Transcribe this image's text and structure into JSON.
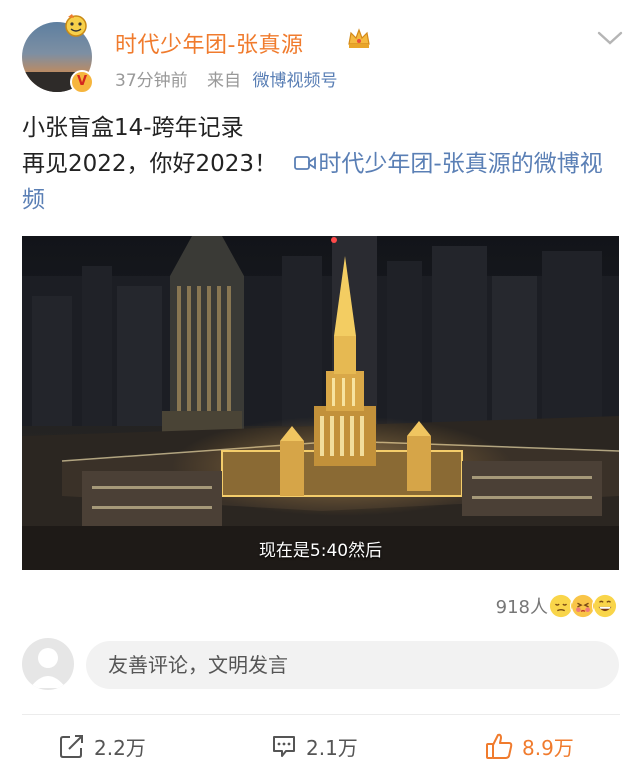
{
  "post": {
    "author": "时代少年团-张真源",
    "verified_badge": "V",
    "time": "37分钟前",
    "source_label": "来自",
    "source": "微博视频号",
    "text_line1": "小张盲盒14-跨年记录",
    "text_line2": "再见2022，你好2023！",
    "video_link": "时代少年团-张真源的微博视频",
    "video_subtitle": "现在是5:40然后"
  },
  "reactions": {
    "count": "918人",
    "emojis": [
      "sleepy-face",
      "kiss-face",
      "grin-face"
    ]
  },
  "comment": {
    "placeholder": "友善评论，文明发言"
  },
  "actions": {
    "share": "2.2万",
    "comments": "2.1万",
    "likes": "8.9万"
  },
  "colors": {
    "username": "#f07b2d",
    "link": "#5a7fb5",
    "like": "#f07b2d"
  }
}
